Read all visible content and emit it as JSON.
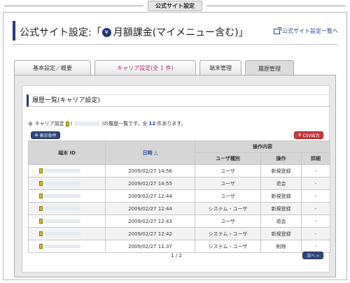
{
  "window": {
    "title": "公式サイト設定"
  },
  "header": {
    "title_prefix": "公式サイト設定:「",
    "title_badge": "¥",
    "title_main": "月額課金(マイメニュー含む)」",
    "link_label": "公式サイト設定一覧へ"
  },
  "tabs": [
    {
      "label": "基本設定／概要"
    },
    {
      "label": "キャリア設定(全 1 件)"
    },
    {
      "label": "端末管理"
    },
    {
      "label": "履歴管理"
    }
  ],
  "section": {
    "title": "履歴一覧(キャリア設定)"
  },
  "summary": {
    "prefix": "キャリア設定",
    "paren_open": "(",
    "middle": ")の履歴一覧です。全",
    "count": "12",
    "suffix": "件あります。"
  },
  "buttons": {
    "filter": "表示条件",
    "csv": "CSV出力",
    "next": "次へ »"
  },
  "table": {
    "headers": {
      "terminal_id": "端末 ID",
      "datetime": "日時 △",
      "operation": "操作内容",
      "user_type": "ユーザ種別",
      "action": "操作",
      "detail": "詳細"
    },
    "rows": [
      {
        "datetime": "2009/02/27 14:56",
        "user_type": "ユーザ",
        "action": "新規登録",
        "detail": "-"
      },
      {
        "datetime": "2009/02/27 14:55",
        "user_type": "ユーザ",
        "action": "退会",
        "detail": "-"
      },
      {
        "datetime": "2009/02/27 12:44",
        "user_type": "ユーザ",
        "action": "新規登録",
        "detail": "-"
      },
      {
        "datetime": "2009/02/27 12:44",
        "user_type": "システム・ユーザ",
        "action": "新規登録",
        "detail": "-"
      },
      {
        "datetime": "2009/02/27 12:43",
        "user_type": "ユーザ",
        "action": "退会",
        "detail": "-"
      },
      {
        "datetime": "2009/02/27 12:42",
        "user_type": "システム・ユーザ",
        "action": "新規登録",
        "detail": "-"
      },
      {
        "datetime": "2009/02/27 11:37",
        "user_type": "システム・ユーザ",
        "action": "削除",
        "detail": "-"
      }
    ]
  },
  "pager": {
    "label": "1 / 2"
  },
  "icons": {
    "badge": "yen-badge-icon",
    "link": "external-link-icon",
    "star": "star-icon",
    "coin": "coin-icon",
    "filter": "filter-icon",
    "csv": "download-icon",
    "next": "next-icon"
  }
}
